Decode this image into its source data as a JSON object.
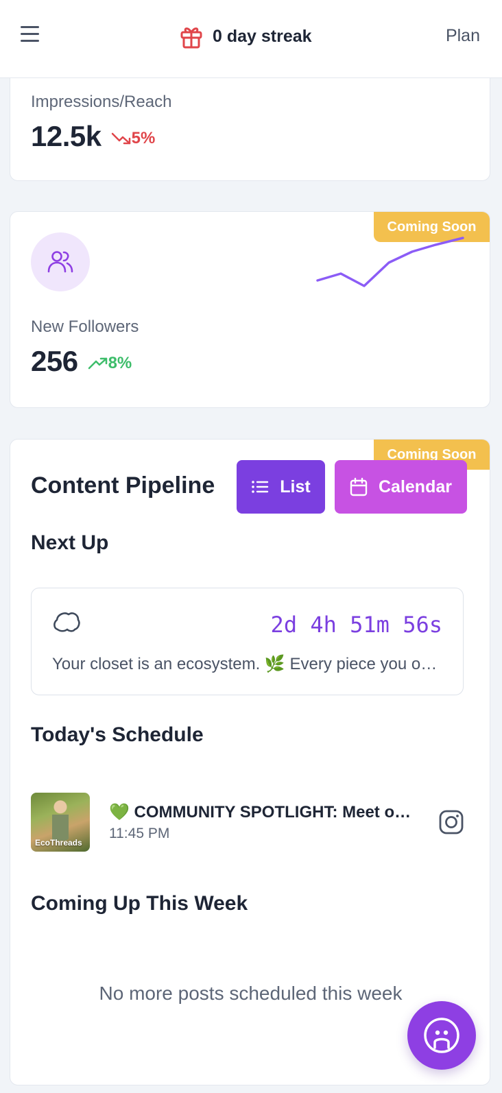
{
  "header": {
    "streak_text": "0 day streak",
    "plan_label": "Plan",
    "gift_color": "#e0454a"
  },
  "impressions": {
    "label": "Impressions/Reach",
    "value": "12.5k",
    "trend": "5%",
    "trend_direction": "down"
  },
  "followers": {
    "label": "New Followers",
    "value": "256",
    "trend": "8%",
    "trend_direction": "up",
    "badge": "Coming Soon",
    "sparkline_color": "#8b5cf6"
  },
  "pipeline": {
    "title": "Content Pipeline",
    "badge": "Coming Soon",
    "list_button": "List",
    "calendar_button": "Calendar",
    "next_up": {
      "heading": "Next Up",
      "countdown": "2d 4h 51m 56s",
      "text": "Your closet is an ecosystem. 🌿 Every piece you own has a story"
    },
    "today": {
      "heading": "Today's Schedule",
      "items": [
        {
          "title": "💚 COMMUNITY SPOTLIGHT: Meet our community",
          "time": "11:45 PM",
          "platform_icon": "instagram-icon",
          "thumb_logo": "EcoThreads"
        }
      ]
    },
    "week": {
      "heading": "Coming Up This Week",
      "empty_text": "No more posts scheduled this week"
    }
  },
  "colors": {
    "primary": "#7b3fe0",
    "secondary": "#c752e3",
    "badge": "#f3c04e",
    "down": "#e0454a",
    "up": "#3dbd6a"
  }
}
